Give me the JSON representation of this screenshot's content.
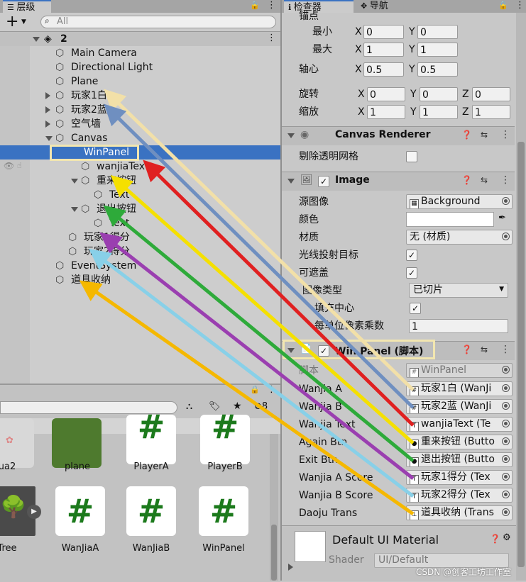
{
  "hierarchy": {
    "tab_label": "层级",
    "search_placeholder": "All",
    "scene": "2",
    "items": [
      {
        "label": "Main Camera"
      },
      {
        "label": "Directional Light"
      },
      {
        "label": "Plane"
      },
      {
        "label": "玩家1白"
      },
      {
        "label": "玩家2蓝"
      },
      {
        "label": "空气墙"
      },
      {
        "label": "Canvas"
      },
      {
        "label": "WinPanel"
      },
      {
        "label": "wanjiaText"
      },
      {
        "label": "重来按钮"
      },
      {
        "label": "Text"
      },
      {
        "label": "退出按钮"
      },
      {
        "label": "Text"
      },
      {
        "label": "玩家1得分"
      },
      {
        "label": "玩家2得分"
      },
      {
        "label": "EventSystem"
      },
      {
        "label": "道具收纳"
      }
    ]
  },
  "project": {
    "count_label": "8",
    "assets_row1": [
      "ua2",
      "plane",
      "PlayerA",
      "PlayerB"
    ],
    "assets_row2": [
      "Tree",
      "WanJiaA",
      "WanJiaB",
      "WinPanel"
    ]
  },
  "inspector": {
    "tab_inspector": "检查器",
    "tab_nav": "导航",
    "anchor_label": "锚点",
    "min_label": "最小",
    "max_label": "最大",
    "pivot_label": "轴心",
    "rotation_label": "旋转",
    "scale_label": "缩放",
    "x": "X",
    "y": "Y",
    "z": "Z",
    "min_x": "0",
    "min_y": "0",
    "max_x": "1",
    "max_y": "1",
    "pivot_x": "0.5",
    "pivot_y": "0.5",
    "rot_x": "0",
    "rot_y": "0",
    "rot_z": "0",
    "scale_x": "1",
    "scale_y": "1",
    "scale_z": "1",
    "canvas_renderer": {
      "title": "Canvas Renderer",
      "cull_label": "剔除透明网格"
    },
    "image": {
      "title": "Image",
      "source_label": "源图像",
      "source_value": "Background",
      "color_label": "颜色",
      "material_label": "材质",
      "material_value": "无 (材质)",
      "raycast_label": "光线投射目标",
      "maskable_label": "可遮盖",
      "type_label": "图像类型",
      "type_value": "已切片",
      "fill_center_label": "填充中心",
      "ppu_label": "每单位像素乘数",
      "ppu_value": "1"
    },
    "winpanel_script": {
      "title": "Win Panel (脚本)",
      "script_label": "脚本",
      "script_value": "WinPanel",
      "fields": [
        {
          "label": "Wanjia A",
          "value": "玩家1白 (WanJi",
          "icon": "#"
        },
        {
          "label": "Wanjia B",
          "value": "玩家2蓝 (WanJi",
          "icon": "#"
        },
        {
          "label": "Wanjia Text",
          "value": "wanjiaText (Te",
          "icon": "T"
        },
        {
          "label": "Again Btn",
          "value": "重来按钮 (Butto",
          "icon": "●"
        },
        {
          "label": "Exit Btn",
          "value": "退出按钮 (Butto",
          "icon": "●"
        },
        {
          "label": "Wanjia A Score",
          "value": "玩家1得分 (Tex",
          "icon": "T"
        },
        {
          "label": "Wanjia B Score",
          "value": "玩家2得分 (Tex",
          "icon": "T"
        },
        {
          "label": "Daoju Trans",
          "value": "道具收纳 (Trans",
          "icon": "⊥"
        }
      ]
    },
    "material": {
      "title": "Default UI Material",
      "shader_label": "Shader",
      "shader_value": "UI/Default"
    }
  },
  "watermark": "CSDN @创客工坊工作室",
  "colors": {
    "selection": "#3a72c2",
    "highlight_box": "#f2e6b0",
    "arrow_wanjiaA": "#f2e0a8",
    "arrow_wanjiaB": "#6f8fc0",
    "arrow_text": "#e02020",
    "arrow_again": "#f5e000",
    "arrow_exit": "#2eaa3a",
    "arrow_scoreA": "#9a3fb0",
    "arrow_scoreB": "#88d0e8",
    "arrow_daoju": "#f5b800"
  }
}
